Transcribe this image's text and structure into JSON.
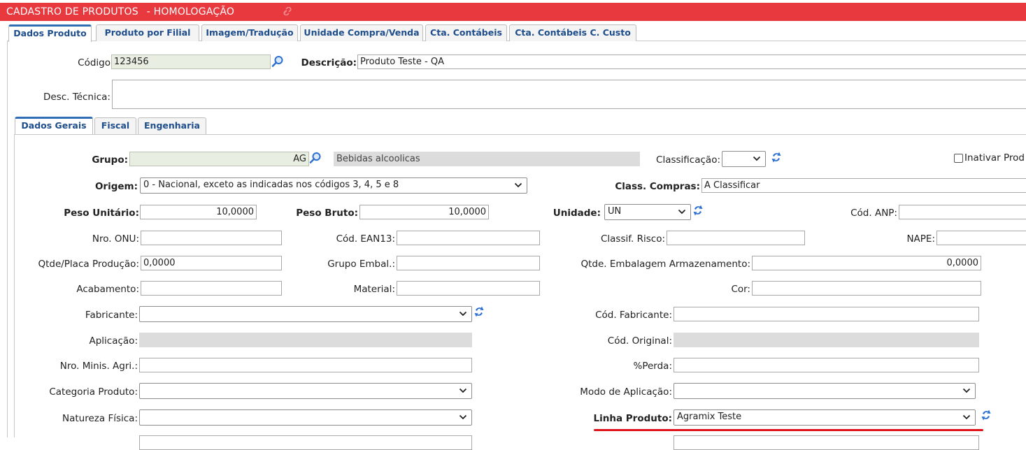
{
  "window": {
    "title_main": "Cadastro de Produtos",
    "title_env": "- Homologação"
  },
  "outer_tabs": [
    {
      "label": "Dados Produto",
      "active": true
    },
    {
      "label": "Produto por Filial",
      "active": false
    },
    {
      "label": "Imagem/Tradução",
      "active": false
    },
    {
      "label": "Unidade Compra/Venda",
      "active": false
    },
    {
      "label": "Cta. Contábeis",
      "active": false
    },
    {
      "label": "Cta. Contábeis C. Custo",
      "active": false
    }
  ],
  "header_form": {
    "codigo_label": "Código",
    "codigo_value": "123456",
    "descricao_label": "Descrição:",
    "descricao_value": "Produto Teste - QA",
    "desc_tecnica_label": "Desc. Técnica:",
    "desc_tecnica_value": ""
  },
  "inner_tabs": [
    {
      "label": "Dados Gerais",
      "active": true
    },
    {
      "label": "Fiscal",
      "active": false
    },
    {
      "label": "Engenharia",
      "active": false
    }
  ],
  "form": {
    "grupo_label": "Grupo:",
    "grupo_code": "AG",
    "grupo_desc": "Bebidas alcoolicas",
    "classificacao_label": "Classificação:",
    "classificacao_value": "",
    "inativar_label": "Inativar Prod",
    "origem_label": "Origem:",
    "origem_value": "0 - Nacional, exceto as indicadas nos códigos 3, 4, 5 e 8",
    "class_compras_label": "Class. Compras:",
    "class_compras_value": "A Classificar",
    "peso_unitario_label": "Peso Unitário:",
    "peso_unitario_value": "10,0000",
    "peso_bruto_label": "Peso Bruto:",
    "peso_bruto_value": "10,0000",
    "unidade_label": "Unidade:",
    "unidade_value": "UN",
    "cod_anp_label": "Cód. ANP:",
    "nro_onu_label": "Nro. ONU:",
    "cod_ean13_label": "Cód. EAN13:",
    "classif_risco_label": "Classif. Risco:",
    "nape_label": "NAPE:",
    "qtde_placa_label": "Qtde/Placa Produção:",
    "qtde_placa_value": "0,0000",
    "grupo_embal_label": "Grupo Embal.:",
    "qtde_embalagem_label": "Qtde. Embalagem Armazenamento:",
    "qtde_embalagem_value": "0,0000",
    "acabamento_label": "Acabamento:",
    "material_label": "Material:",
    "cor_label": "Cor:",
    "fabricante_label": "Fabricante:",
    "cod_fabricante_label": "Cód. Fabricante:",
    "aplicacao_label": "Aplicação:",
    "cod_original_label": "Cód. Original:",
    "nro_minis_label": "Nro. Minis. Agri.:",
    "perda_label": "%Perda:",
    "categoria_label": "Categoria Produto:",
    "modo_aplicacao_label": "Modo de Aplicação:",
    "natureza_label": "Natureza Física:",
    "linha_produto_label": "Linha Produto:",
    "linha_produto_value": "Agramix Teste"
  },
  "colors": {
    "title_bar": "#e8393f",
    "tab_text": "#1f4e8c",
    "refresh_icon": "#2a6fd1",
    "highlight_underline": "#e0121a"
  },
  "icons": [
    "link-icon",
    "search-icon",
    "refresh-icon",
    "chevron-down-icon",
    "checkbox"
  ]
}
